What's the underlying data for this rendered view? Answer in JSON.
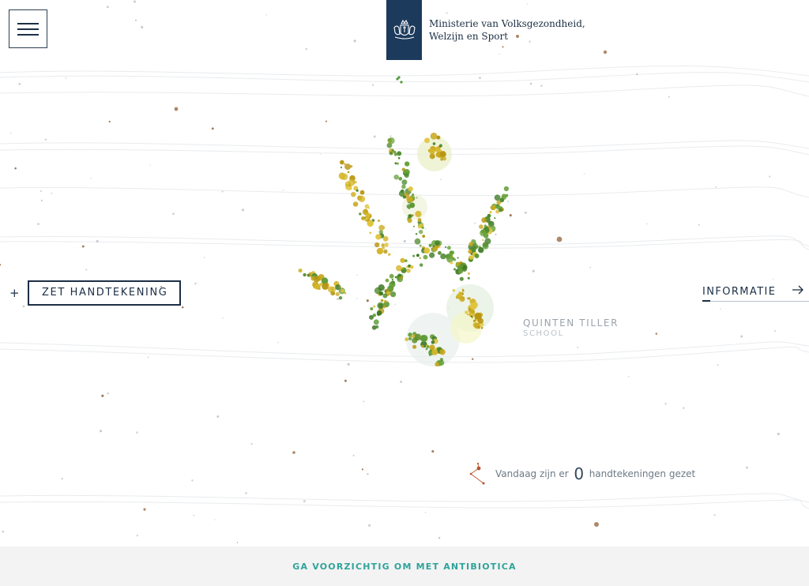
{
  "header": {
    "menu_icon": "hamburger-menu-icon",
    "logo": {
      "emblem": "royal-coat-of-arms-icon",
      "line1": "Ministerie van Volksgezondheid,",
      "line2": "Welzijn en Sport",
      "ribbon_color": "#1c3a5c"
    }
  },
  "actions": {
    "sign_plus": "+",
    "sign_label": "ZET HANDTEKENING",
    "info_label": "INFORMATIE"
  },
  "signature": {
    "name": "QUINTEN TILLER",
    "role": "SCHOOL"
  },
  "counter": {
    "prefix": "Vandaag zijn er",
    "count": "0",
    "suffix": "handtekeningen gezet"
  },
  "footer": {
    "link": "GA VOORZICHTIG OM MET ANTIBIOTICA",
    "link_color": "#2fa39a"
  },
  "colors": {
    "navy": "#1c2f45",
    "leaf_green": "#4f8b2e",
    "leaf_yellow": "#c9a81e",
    "dust_brown": "#9a6a44"
  }
}
